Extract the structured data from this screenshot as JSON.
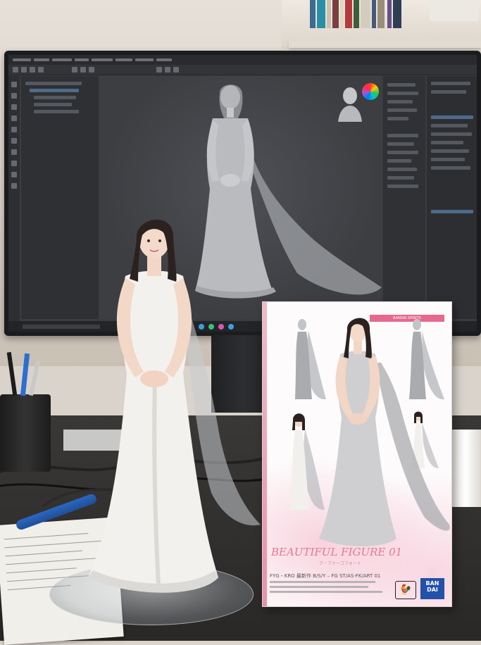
{
  "scene": "Photo of a white-dress figurine on a clear base in front of a monitor showing a 3D sculpting application, next to the figure's retail box",
  "box": {
    "brand_tag": "BANDAI SPIRITS",
    "title": "BEAUTIFUL FIGURE 01",
    "subtitle": "ク・ファーコフォート",
    "product_line": "FYG・KRO 最新作 B/S/Y – FG ST/AS-FK/ART 01",
    "logo_bandai": "BAN DAI",
    "logo_tamashii": "🐓"
  },
  "colors": {
    "accent_pink": "#e77796",
    "bandai_blue": "#2350a8",
    "screen_bg": "#3a3c40"
  },
  "icons": [
    "color-wheel-icon",
    "tool-icons",
    "pen-cup-icon",
    "marker-icon",
    "mug-icon"
  ]
}
